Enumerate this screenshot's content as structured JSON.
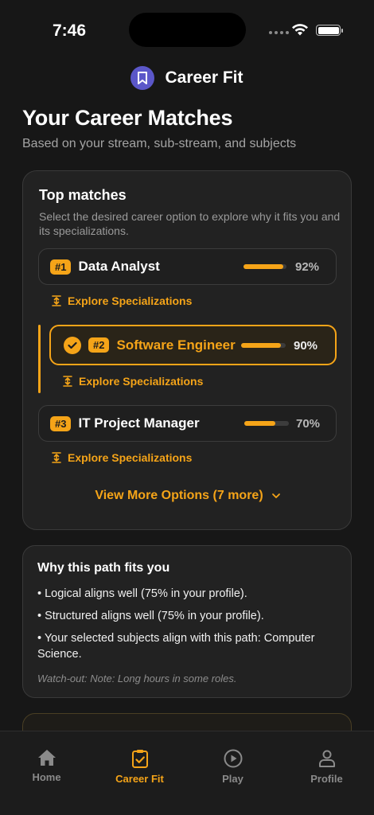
{
  "status": {
    "time": "7:46"
  },
  "header": {
    "app_title": "Career Fit",
    "logo_icon": "bookmark-icon"
  },
  "page": {
    "title": "Your Career Matches",
    "subtitle": "Based on your stream, sub-stream, and subjects"
  },
  "matches": {
    "title": "Top matches",
    "description": "Select the desired career option to explore why it fits you and its specializations.",
    "items": [
      {
        "rank": "#1",
        "name": "Data Analyst",
        "percent": "92%",
        "value": 92,
        "selected": false
      },
      {
        "rank": "#2",
        "name": "Software Engineer",
        "percent": "90%",
        "value": 90,
        "selected": true
      },
      {
        "rank": "#3",
        "name": "IT Project Manager",
        "percent": "70%",
        "value": 70,
        "selected": false
      }
    ],
    "explore_label": "Explore Specializations",
    "view_more": "View More Options (7 more)"
  },
  "why": {
    "title": "Why this path fits you",
    "points": [
      "• Logical aligns well (75% in your profile).",
      "• Structured aligns well (75% in your profile).",
      "• Your selected subjects align with this path: Computer Science."
    ],
    "note": "Watch-out: Note: Long hours in some roles."
  },
  "nav": {
    "items": [
      {
        "label": "Home",
        "icon": "home-icon",
        "active": false
      },
      {
        "label": "Career Fit",
        "icon": "clipboard-check-icon",
        "active": true
      },
      {
        "label": "Play",
        "icon": "play-circle-icon",
        "active": false
      },
      {
        "label": "Profile",
        "icon": "person-icon",
        "active": false
      }
    ]
  },
  "colors": {
    "accent": "#f5a418",
    "background": "#171717",
    "card": "#222222",
    "logo": "#5b57c9"
  }
}
